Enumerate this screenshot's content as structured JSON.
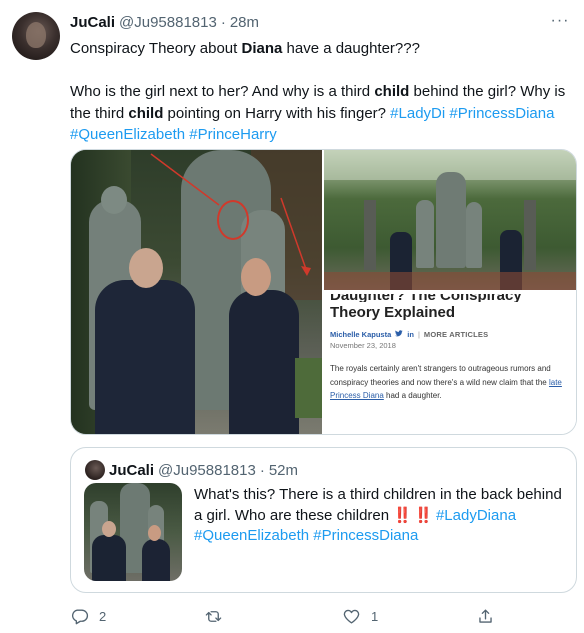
{
  "tweet": {
    "author_name": "JuCali",
    "handle": "@Ju95881813",
    "separator": "·",
    "time": "28m",
    "more_icon": "more-dots-icon",
    "line1_pre": "Conspiracy Theory about ",
    "line1_bold": "Diana",
    "line1_post": " have a daughter???",
    "line2_a": "Who is the girl next to her? And why is a third ",
    "line2_bold1": "child",
    "line2_b": " behind the girl? Why is the third ",
    "line2_bold2": "child",
    "line2_c": " pointing on Harry with his finger? ",
    "hashtags": [
      "#LadyDi",
      "#PrincessDiana",
      "#QueenElizabeth",
      "#PrinceHarry"
    ]
  },
  "article_card": {
    "cut_title": "Daughter? The Conspiracy",
    "title": "Theory Explained",
    "author": "Michelle Kapusta",
    "social_twitter": "🐦",
    "social_linkedin": "in",
    "sep": "|",
    "more_articles": "MORE ARTICLES",
    "date": "November 23, 2018",
    "body_pre": "The royals certainly aren't strangers to outrageous rumors and conspiracy theories and now there's a wild new claim that the ",
    "body_link": "late Princess Diana",
    "body_post": " had a daughter."
  },
  "quote": {
    "author_name": "JuCali",
    "handle": "@Ju95881813",
    "separator": "·",
    "time": "52m",
    "text_pre": "What's this? There is a third children in the back behind a girl. Who are these children ",
    "bangs": "‼️ ‼️",
    "hashtags": [
      "#LadyDiana",
      "#QueenElizabeth",
      "#PrincessDiana"
    ]
  },
  "actions": {
    "reply_count": "2",
    "retweet_count": "",
    "like_count": "1",
    "icons": [
      "reply-icon",
      "retweet-icon",
      "like-icon",
      "share-icon"
    ]
  },
  "colors": {
    "link": "#1d9bf0",
    "muted": "#536471",
    "border": "#cfd9de",
    "annotation_red": "#d0392b"
  }
}
